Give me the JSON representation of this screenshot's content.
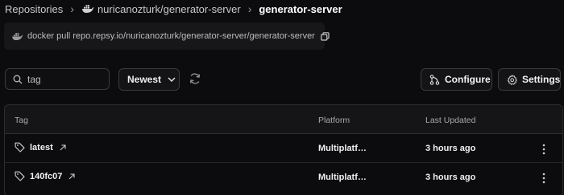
{
  "breadcrumb": {
    "root": "Repositories",
    "repo": "nuricanozturk/generator-server",
    "current": "generator-server"
  },
  "pull_box": {
    "command": "docker pull repo.repsy.io/nuricanozturk/generator-server/generator-server"
  },
  "toolbar": {
    "search_placeholder": "tag",
    "sort_value": "Newest",
    "configure_label": "Configure",
    "settings_label": "Settings"
  },
  "table": {
    "headers": {
      "tag": "Tag",
      "platform": "Platform",
      "last_updated": "Last Updated"
    },
    "rows": [
      {
        "tag": "latest",
        "platform": "Multiplatf…",
        "last_updated": "3 hours ago"
      },
      {
        "tag": "140fc07",
        "platform": "Multiplatf…",
        "last_updated": "3 hours ago"
      }
    ]
  },
  "icons": {
    "breadcrumb_repo": "docker-whale-icon",
    "pull": "docker-whale-icon",
    "copy": "copy-icon",
    "search": "search-icon",
    "sort": "chevron-down-icon",
    "refresh": "refresh-icon",
    "configure": "branch-icon",
    "settings": "gear-icon",
    "tag": "tag-icon",
    "external": "arrow-up-right-icon",
    "row_menu": "kebab-menu-icon"
  },
  "colors": {
    "background": "#0c0c0e",
    "panel": "#17171a",
    "border": "#3a3a3e",
    "text_primary": "#f2f2f2",
    "text_secondary": "#a9a9a9"
  }
}
